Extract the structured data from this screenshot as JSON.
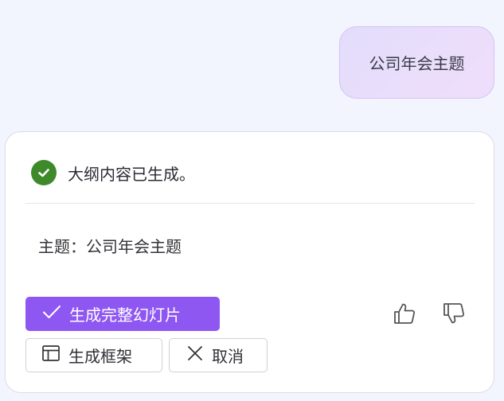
{
  "user_message": {
    "text": "公司年会主题"
  },
  "assistant": {
    "status_text": "大纲内容已生成。",
    "topic_line": "主题：公司年会主题",
    "buttons": {
      "generate_full_label": "生成完整幻灯片",
      "generate_framework_label": "生成框架",
      "cancel_label": "取消"
    },
    "feedback": {
      "like_icon": "thumbs-up-icon",
      "dislike_icon": "thumbs-down-icon"
    }
  },
  "colors": {
    "page_bg": "#f2f4fe",
    "primary": "#8f57f2",
    "success": "#3e8a2b",
    "bubble_border": "#d5c1f4"
  }
}
